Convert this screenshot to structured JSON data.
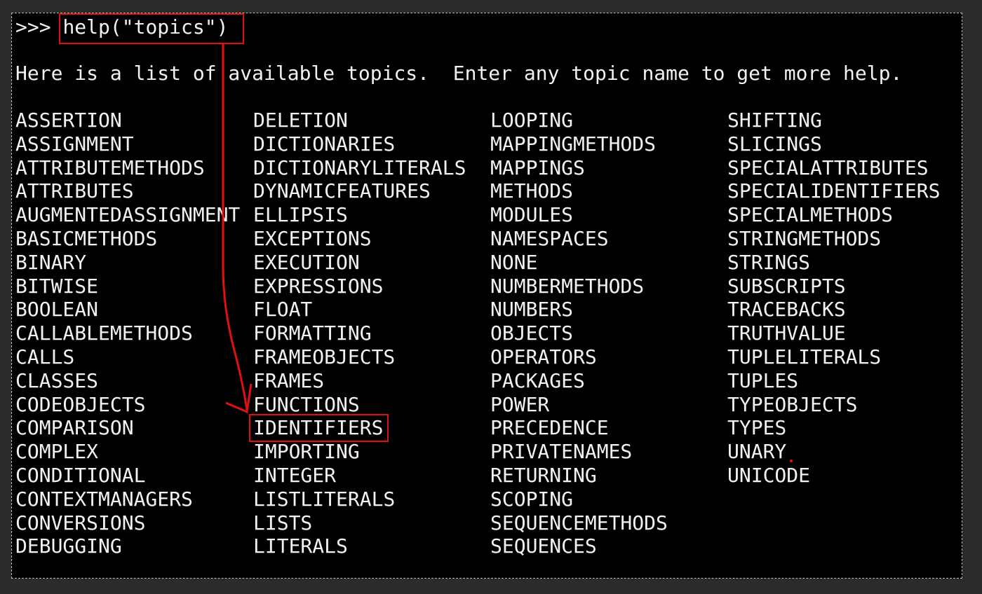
{
  "prompt": ">>> ",
  "command": "help(\"topics\")",
  "intro": "Here is a list of available topics.  Enter any topic name to get more help.",
  "columns": [
    [
      "ASSERTION",
      "ASSIGNMENT",
      "ATTRIBUTEMETHODS",
      "ATTRIBUTES",
      "AUGMENTEDASSIGNMENT",
      "BASICMETHODS",
      "BINARY",
      "BITWISE",
      "BOOLEAN",
      "CALLABLEMETHODS",
      "CALLS",
      "CLASSES",
      "CODEOBJECTS",
      "COMPARISON",
      "COMPLEX",
      "CONDITIONAL",
      "CONTEXTMANAGERS",
      "CONVERSIONS",
      "DEBUGGING"
    ],
    [
      "DELETION",
      "DICTIONARIES",
      "DICTIONARYLITERALS",
      "DYNAMICFEATURES",
      "ELLIPSIS",
      "EXCEPTIONS",
      "EXECUTION",
      "EXPRESSIONS",
      "FLOAT",
      "FORMATTING",
      "FRAMEOBJECTS",
      "FRAMES",
      "FUNCTIONS",
      "IDENTIFIERS",
      "IMPORTING",
      "INTEGER",
      "LISTLITERALS",
      "LISTS",
      "LITERALS"
    ],
    [
      "LOOPING",
      "MAPPINGMETHODS",
      "MAPPINGS",
      "METHODS",
      "MODULES",
      "NAMESPACES",
      "NONE",
      "NUMBERMETHODS",
      "NUMBERS",
      "OBJECTS",
      "OPERATORS",
      "PACKAGES",
      "POWER",
      "PRECEDENCE",
      "PRIVATENAMES",
      "RETURNING",
      "SCOPING",
      "SEQUENCEMETHODS",
      "SEQUENCES"
    ],
    [
      "SHIFTING",
      "SLICINGS",
      "SPECIALATTRIBUTES",
      "SPECIALIDENTIFIERS",
      "SPECIALMETHODS",
      "STRINGMETHODS",
      "STRINGS",
      "SUBSCRIPTS",
      "TRACEBACKS",
      "TRUTHVALUE",
      "TUPLELITERALS",
      "TUPLES",
      "TYPEOBJECTS",
      "TYPES",
      "UNARY",
      "UNICODE"
    ]
  ],
  "highlight_color": "#e01010"
}
